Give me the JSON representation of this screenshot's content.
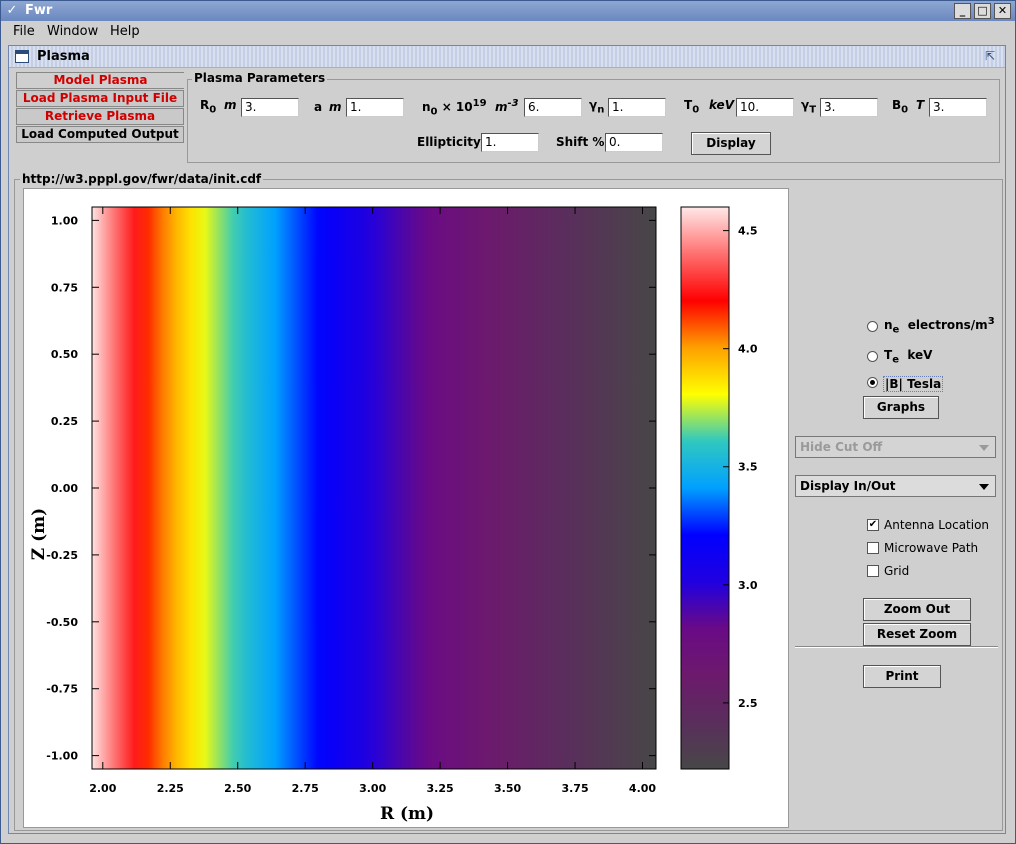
{
  "window": {
    "title": "Fwr"
  },
  "menu": [
    "File",
    "Window",
    "Help"
  ],
  "internal_frame": {
    "title": "Plasma"
  },
  "tabs": [
    {
      "label": "Model Plasma",
      "selected": true
    },
    {
      "label": "Load Plasma Input File",
      "selected": false
    },
    {
      "label": "Retrieve Plasma",
      "selected": false
    },
    {
      "label": "Load Computed Output",
      "selected": false
    }
  ],
  "params": {
    "group_label": "Plasma Parameters",
    "R0_label": "R",
    "R0_sub": "0",
    "R0_unit": "m",
    "R0_value": "3.",
    "a_label": "a",
    "a_unit": "m",
    "a_value": "1.",
    "n0_label": "n",
    "n0_sub": "0",
    "n0_mult": "× 10",
    "n0_exp": "19",
    "n0_unit": "m",
    "n0_unit_exp": "-3",
    "n0_value": "6.",
    "gn_label": "γ",
    "gn_sub": "n",
    "gn_value": "1.",
    "T0_label": "T",
    "T0_sub": "0",
    "T0_unit": "keV",
    "T0_value": "10.",
    "gT_label": "γ",
    "gT_sub": "T",
    "gT_value": "3.",
    "B0_label": "B",
    "B0_sub": "0",
    "B0_unit": "T",
    "B0_value": "3.",
    "ellip_label": "Ellipticity",
    "ellip_value": "1.",
    "shift_label": "Shift %",
    "shift_value": "0.",
    "display_button": "Display"
  },
  "url": "http://w3.pppl.gov/fwr/data/init.cdf",
  "controls": {
    "radio_ne_main": "n",
    "radio_ne_sub": "e",
    "radio_ne_unit": "electrons/m",
    "radio_ne_exp": "3",
    "radio_te_main": "T",
    "radio_te_sub": "e",
    "radio_te_unit": "keV",
    "radio_b_label": "|B|  Tesla",
    "selected_radio": "B",
    "graphs_button": "Graphs",
    "cutoff_combo": "Hide Cut Off",
    "display_combo": "Display In/Out",
    "antenna_label": "Antenna Location",
    "antenna_checked": true,
    "microwave_label": "Microwave Path",
    "microwave_checked": false,
    "grid_label": "Grid",
    "grid_checked": false,
    "zoom_out_button": "Zoom Out",
    "reset_zoom_button": "Reset Zoom",
    "print_button": "Print"
  },
  "chart_data": {
    "type": "heatmap",
    "xlabel": "R (m)",
    "ylabel": "Z (m)",
    "xlim": [
      1.96,
      4.05
    ],
    "ylim": [
      -1.05,
      1.05
    ],
    "x_ticks": [
      2.0,
      2.25,
      2.5,
      2.75,
      3.0,
      3.25,
      3.5,
      3.75,
      4.0
    ],
    "x_tick_labels": [
      "2.00",
      "2.25",
      "2.50",
      "2.75",
      "3.00",
      "3.25",
      "3.50",
      "3.75",
      "4.00"
    ],
    "y_ticks": [
      1.0,
      0.75,
      0.5,
      0.25,
      0.0,
      -0.25,
      -0.5,
      -0.75,
      -1.0
    ],
    "y_tick_labels": [
      "1.00",
      "0.75",
      "0.50",
      "0.25",
      "0.00",
      "-0.25",
      "-0.50",
      "-0.75",
      "-1.00"
    ],
    "colorbar": {
      "range": [
        2.22,
        4.6
      ],
      "ticks": [
        4.5,
        4.0,
        3.5,
        3.0,
        2.5
      ],
      "tick_labels": [
        "4.5",
        "4.0",
        "3.5",
        "3.0",
        "2.5"
      ],
      "colors": [
        "#474747",
        "#5a2e5c",
        "#6c1a6c",
        "#6a0a86",
        "#2000e0",
        "#0000ff",
        "#00a0ff",
        "#30c8c0",
        "#ffff00",
        "#ffa000",
        "#ff0000",
        "#ff7070",
        "#ffe8e8"
      ]
    },
    "field": "|B| = B0 * R0 / R",
    "B0": 3.0,
    "R0": 3.0
  }
}
